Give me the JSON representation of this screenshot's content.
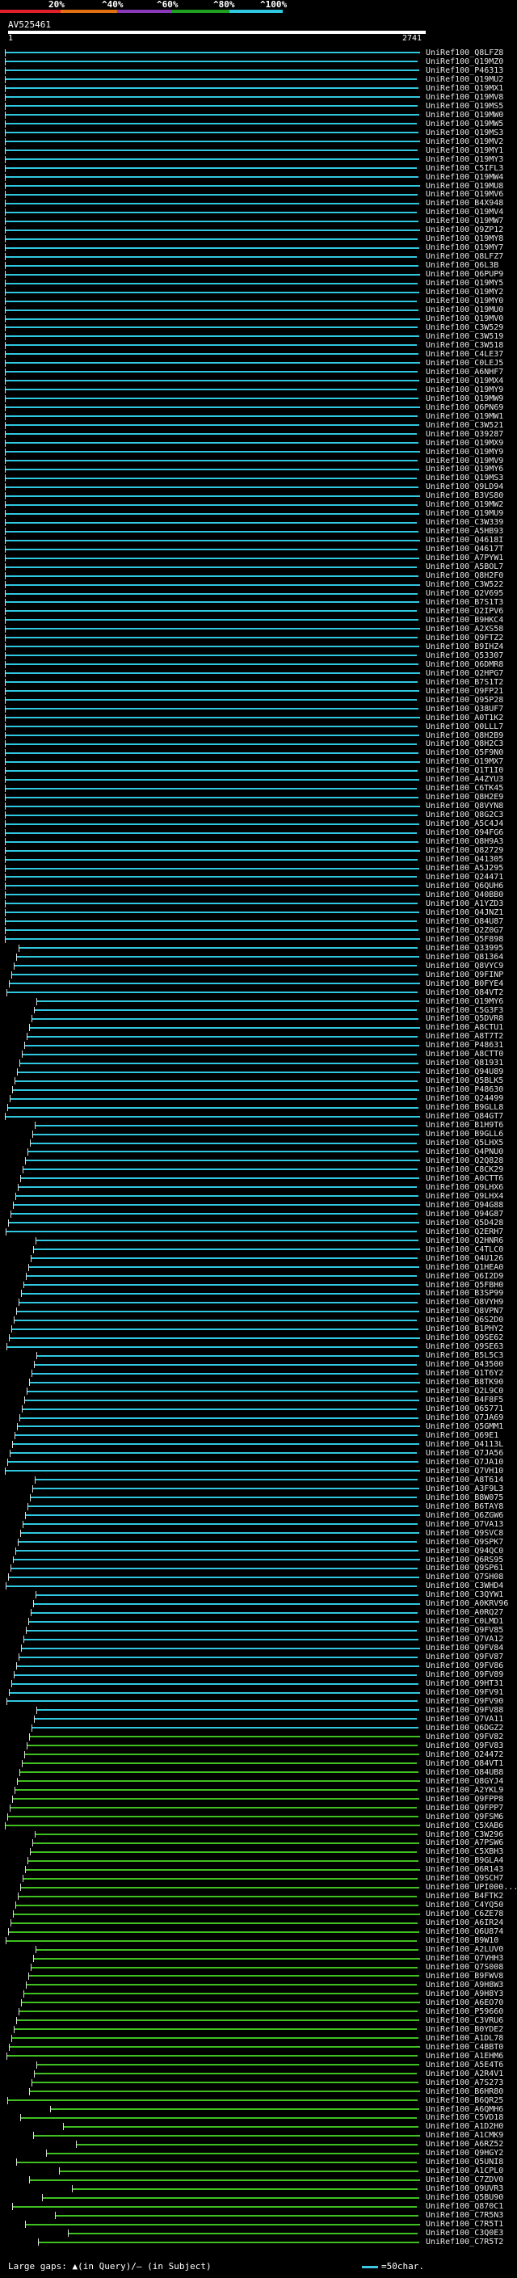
{
  "legend": {
    "labels": [
      "20%",
      "^40%",
      "^60%",
      "^80%",
      "^100%"
    ],
    "colors": [
      "#e0202a",
      "#e07010",
      "#8a3ab8",
      "#20a020",
      "#30c8e0"
    ]
  },
  "query": {
    "title": "AV525461",
    "start": "1",
    "end": "2741"
  },
  "hits": [
    "UniRef100_Q8LFZ8",
    "UniRef100_Q19MZ0",
    "UniRef100_P46313",
    "UniRef100_Q19MU2",
    "UniRef100_Q19MX1",
    "UniRef100_Q19MV8",
    "UniRef100_Q19MS5",
    "UniRef100_Q19MW0",
    "UniRef100_Q19MW5",
    "UniRef100_Q19MS3",
    "UniRef100_Q19MV2",
    "UniRef100_Q19MY1",
    "UniRef100_Q19MY3",
    "UniRef100_C5IFL3",
    "UniRef100_Q19MW4",
    "UniRef100_Q19MU8",
    "UniRef100_Q19MV6",
    "UniRef100_B4X948",
    "UniRef100_Q19MV4",
    "UniRef100_Q19MW7",
    "UniRef100_Q9ZP12",
    "UniRef100_Q19MY8",
    "UniRef100_Q19MY7",
    "UniRef100_Q8LFZ7",
    "UniRef100_Q6L3B",
    "UniRef100_Q6PUP9",
    "UniRef100_Q19MY5",
    "UniRef100_Q19MY2",
    "UniRef100_Q19MY0",
    "UniRef100_Q19MU0",
    "UniRef100_Q19MV0",
    "UniRef100_C3W529",
    "UniRef100_C3W519",
    "UniRef100_C3W518",
    "UniRef100_C4LE37",
    "UniRef100_C0LEJ5",
    "UniRef100_A6NHF7",
    "UniRef100_Q19MX4",
    "UniRef100_Q19MY9",
    "UniRef100_Q19MW9",
    "UniRef100_Q6PN69",
    "UniRef100_Q19MW1",
    "UniRef100_C3W521",
    "UniRef100_Q39287",
    "UniRef100_Q19MX9",
    "UniRef100_Q19MY9",
    "UniRef100_Q19MV9",
    "UniRef100_Q19MY6",
    "UniRef100_Q19MS3",
    "UniRef100_Q9LD94",
    "UniRef100_B3VS80",
    "UniRef100_Q19MW2",
    "UniRef100_Q19MU9",
    "UniRef100_C3W339",
    "UniRef100_A5HB93",
    "UniRef100_Q4618I",
    "UniRef100_Q4617T",
    "UniRef100_A7PYW1",
    "UniRef100_A5BOL7",
    "UniRef100_Q8H2F0",
    "UniRef100_C3W522",
    "UniRef100_Q2V695",
    "UniRef100_B7S1T3",
    "UniRef100_Q2IPV6",
    "UniRef100_B9HKC4",
    "UniRef100_A2XS58",
    "UniRef100_Q9FTZ2",
    "UniRef100_B9IHZ4",
    "UniRef100_Q53307",
    "UniRef100_Q6DMR8",
    "UniRef100_Q2HPG7",
    "UniRef100_B7S1T2",
    "UniRef100_Q9FP21",
    "UniRef100_Q95P28",
    "UniRef100_Q38UF7",
    "UniRef100_A0T1K2",
    "UniRef100_Q0LLL7",
    "UniRef100_Q8H2B9",
    "UniRef100_Q8H2C3",
    "UniRef100_Q5F9N0",
    "UniRef100_Q19MX7",
    "UniRef100_Q1T1I0",
    "UniRef100_A4ZYU3",
    "UniRef100_C6TK45",
    "UniRef100_Q8H2E9",
    "UniRef100_Q8VYN8",
    "UniRef100_Q8G2C3",
    "UniRef100_A5C4J4",
    "UniRef100_Q94FG6",
    "UniRef100_Q8H9A3",
    "UniRef100_Q82729",
    "UniRef100_Q41305",
    "UniRef100_A5J295",
    "UniRef100_Q24471",
    "UniRef100_Q6QUH6",
    "UniRef100_Q40BB0",
    "UniRef100_A1YZD3",
    "UniRef100_Q4JNZ1",
    "UniRef100_Q84U87",
    "UniRef100_Q2Z0G7",
    "UniRef100_Q5F898",
    "UniRef100_Q33995",
    "UniRef100_Q81364",
    "UniRef100_Q8VYC9",
    "UniRef100_Q9FINP",
    "UniRef100_B0FYE4",
    "UniRef100_Q84VT2",
    "UniRef100_Q19MY6",
    "UniRef100_C5G3F3",
    "UniRef100_Q5DVR8",
    "UniRef100_A8CTU1",
    "UniRef100_A8T7T2",
    "UniRef100_P48631",
    "UniRef100_A8CTT0",
    "UniRef100_Q81931",
    "UniRef100_Q94U89",
    "UniRef100_Q5BLK5",
    "UniRef100_P48630",
    "UniRef100_Q24499",
    "UniRef100_B9GLL8",
    "UniRef100_Q84GT7",
    "UniRef100_B1H9T6",
    "UniRef100_B9GLL6",
    "UniRef100_Q5LHX5",
    "UniRef100_Q4PNU0",
    "UniRef100_Q2Q828",
    "UniRef100_C8CK29",
    "UniRef100_A0CTT6",
    "UniRef100_Q9LHX6",
    "UniRef100_Q9LHX4",
    "UniRef100_Q94G88",
    "UniRef100_Q94G87",
    "UniRef100_Q5D428",
    "UniRef100_Q2ERH7",
    "UniRef100_Q2HNR6",
    "UniRef100_C4TLC0",
    "UniRef100_Q4U126",
    "UniRef100_Q1HEA0",
    "UniRef100_Q6I2D9",
    "UniRef100_Q5FBH0",
    "UniRef100_B3SP99",
    "UniRef100_Q8VYH9",
    "UniRef100_Q8VPN7",
    "UniRef100_Q6S2D0",
    "UniRef100_B1PHY2",
    "UniRef100_Q9SE62",
    "UniRef100_Q9SE63",
    "UniRef100_B5L5C3",
    "UniRef100_Q43500",
    "UniRef100_Q1T6Y2",
    "UniRef100_B8TK90",
    "UniRef100_Q2L9C0",
    "UniRef100_B4F8F5",
    "UniRef100_Q65771",
    "UniRef100_Q7JA69",
    "UniRef100_Q5GMM1",
    "UniRef100_Q69E1",
    "UniRef100_Q4113L",
    "UniRef100_Q7JA56",
    "UniRef100_Q7JA10",
    "UniRef100_Q7VH10",
    "UniRef100_A8T614",
    "UniRef100_A3F9L3",
    "UniRef100_B8W075",
    "UniRef100_B6TAY8",
    "UniRef100_Q6ZGW6",
    "UniRef100_Q7VA13",
    "UniRef100_Q9SVC8",
    "UniRef100_Q9SPK7",
    "UniRef100_Q94QC0",
    "UniRef100_Q6RS95",
    "UniRef100_Q9SP61",
    "UniRef100_Q7SH08",
    "UniRef100_C3WHD4",
    "UniRef100_C3QYW1",
    "UniRef100_A0KRV96",
    "UniRef100_A0RQ27",
    "UniRef100_C0LMD1",
    "UniRef100_Q9FV85",
    "UniRef100_Q7VA12",
    "UniRef100_Q9FV84",
    "UniRef100_Q9FV87",
    "UniRef100_Q9FV86",
    "UniRef100_Q9FV89",
    "UniRef100_Q9HT31",
    "UniRef100_Q9FV91",
    "UniRef100_Q9FV90",
    "UniRef100_Q9FV88",
    "UniRef100_Q7VA11",
    "UniRef100_Q6DGZ2",
    "UniRef100_Q9FV82",
    "UniRef100_Q9FV83",
    "UniRef100_Q24472",
    "UniRef100_Q84VT1",
    "UniRef100_Q84UB8",
    "UniRef100_Q8GYJ4",
    "UniRef100_A2YKL9",
    "UniRef100_Q9FPP8",
    "UniRef100_Q9FPP7",
    "UniRef100_Q9FSM6",
    "UniRef100_C5XAB6",
    "UniRef100_C3W296",
    "UniRef100_A7PSW6",
    "UniRef100_C5XBH3",
    "UniRef100_B9GLA4",
    "UniRef100_Q6R143",
    "UniRef100_Q9SCH7",
    "UniRef100_UPI000...",
    "UniRef100_B4FTK2",
    "UniRef100_C4YQ50",
    "UniRef100_C6ZE78",
    "UniRef100_A6IR24",
    "UniRef100_Q6U874",
    "UniRef100_B9W10",
    "UniRef100_A2LUV0",
    "UniRef100_Q7VHH3",
    "UniRef100_Q7S008",
    "UniRef100_B9FWV8",
    "UniRef100_A9H8W3",
    "UniRef100_A9H8Y3",
    "UniRef100_A6EO70",
    "UniRef100_P59660",
    "UniRef100_C3VRU6",
    "UniRef100_B0YDE2",
    "UniRef100_A1DL78",
    "UniRef100_C4BBT0",
    "UniRef100_A1EHM6",
    "UniRef100_A5E4T6",
    "UniRef100_A2R4V1",
    "UniRef100_A7S273",
    "UniRef100_B6HR80",
    "UniRef100_B6QR25",
    "UniRef100_A6QMH6",
    "UniRef100_C5VD18",
    "UniRef100_A1D2H0",
    "UniRef100_A1CMK9",
    "UniRef100_A6RZ52",
    "UniRef100_Q9HGY2",
    "UniRef100_Q5UNI8",
    "UniRef100_A1CPL0",
    "UniRef100_C7ZDV0",
    "UniRef100_Q9UVR3",
    "UniRef100_Q5BU90",
    "UniRef100_Q870C1",
    "UniRef100_C7R5N3",
    "UniRef100_C7R5T1",
    "UniRef100_C3Q0E3",
    "UniRef100_C7R5T2"
  ],
  "footer": {
    "left": "Large gaps: ▲(in Query)/– (in Subject)",
    "right": "=50char."
  }
}
